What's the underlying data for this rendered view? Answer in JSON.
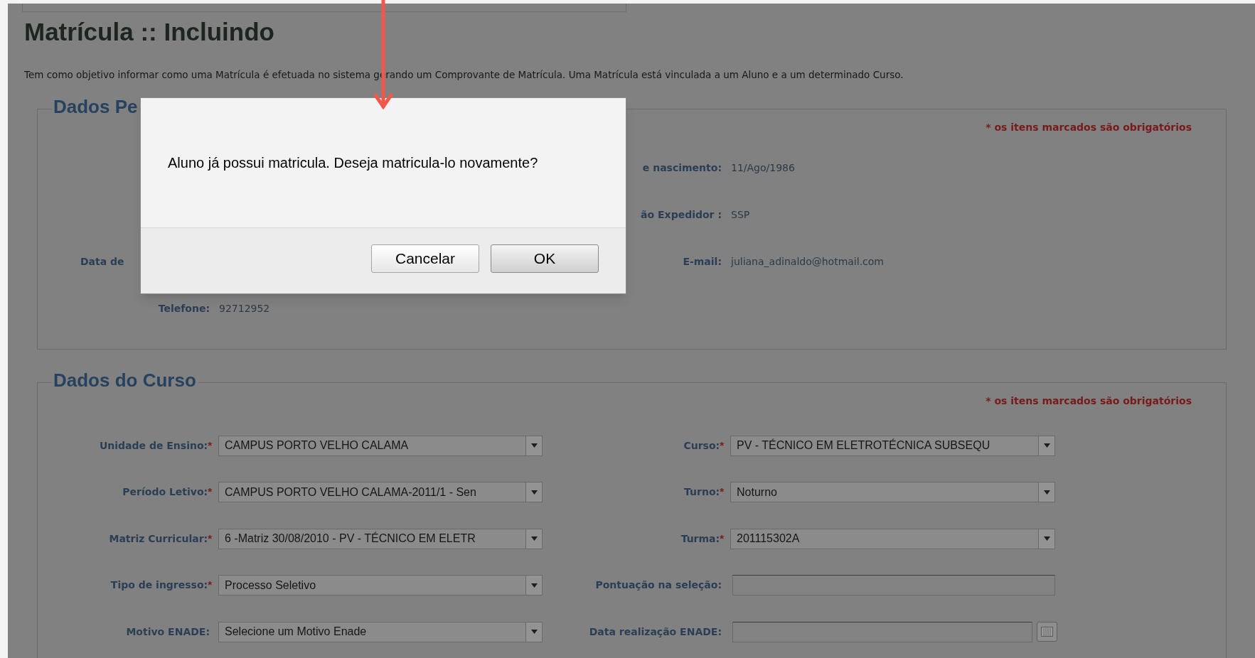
{
  "page": {
    "title": "Matrícula :: Incluindo",
    "description": "Tem como objetivo informar como uma Matrícula é efetuada no sistema gerando um Comprovante de Matrícula. Uma Matrícula está vinculada a um Aluno e a um determinado Curso."
  },
  "personal": {
    "legend": "Dados Pe",
    "required_note": "* os itens marcados são obrigatórios",
    "rows": [
      {
        "right": {
          "label": "e nascimento:",
          "value": "11/Ago/1986"
        }
      },
      {
        "right": {
          "label": "ão Expedidor :",
          "value": "SSP"
        }
      },
      {
        "left": {
          "label": "Data de",
          "clipped": true
        },
        "right": {
          "label": "E-mail:",
          "value": "juliana_adinaldo@hotmail.com"
        }
      },
      {
        "left": {
          "label": "Telefone:",
          "value": "92712952",
          "clipped": false
        }
      }
    ]
  },
  "course": {
    "legend": "Dados do Curso",
    "required_note": "* os itens marcados são obrigatórios",
    "rows": [
      {
        "left": {
          "label": "Unidade de Ensino:",
          "mark": "*",
          "kind": "select",
          "value": "CAMPUS PORTO VELHO CALAMA"
        },
        "right": {
          "label": "Curso:",
          "mark": "*",
          "kind": "select",
          "value": "PV - TÉCNICO EM ELETROTÉCNICA SUBSEQU"
        }
      },
      {
        "left": {
          "label": "Período Letivo:",
          "mark": "*",
          "kind": "select",
          "value": "CAMPUS PORTO VELHO CALAMA-2011/1 - Sen"
        },
        "right": {
          "label": "Turno:",
          "mark": "*",
          "kind": "select",
          "value": "Noturno"
        }
      },
      {
        "left": {
          "label": "Matriz Curricular:",
          "mark": "*",
          "kind": "select",
          "value": "6 -Matriz 30/08/2010 - PV - TÉCNICO EM ELETR"
        },
        "right": {
          "label": "Turma:",
          "mark": "*",
          "kind": "select",
          "value": "201115302A"
        }
      },
      {
        "left": {
          "label": "Tipo de ingresso:",
          "mark": "*",
          "kind": "select",
          "value": "Processo Seletivo"
        },
        "right": {
          "label": "Pontuação na seleção:",
          "kind": "text"
        }
      },
      {
        "left": {
          "label": "Motivo ENADE:",
          "kind": "select",
          "value": "Selecione um Motivo Enade"
        },
        "right": {
          "label": "Data realização ENADE:",
          "kind": "date"
        }
      }
    ]
  },
  "dialog": {
    "message": "Aluno já possui matricula. Deseja matricula-lo novamente?",
    "buttons": [
      {
        "label": "Cancelar",
        "default": false
      },
      {
        "label": "OK",
        "default": true
      }
    ]
  }
}
